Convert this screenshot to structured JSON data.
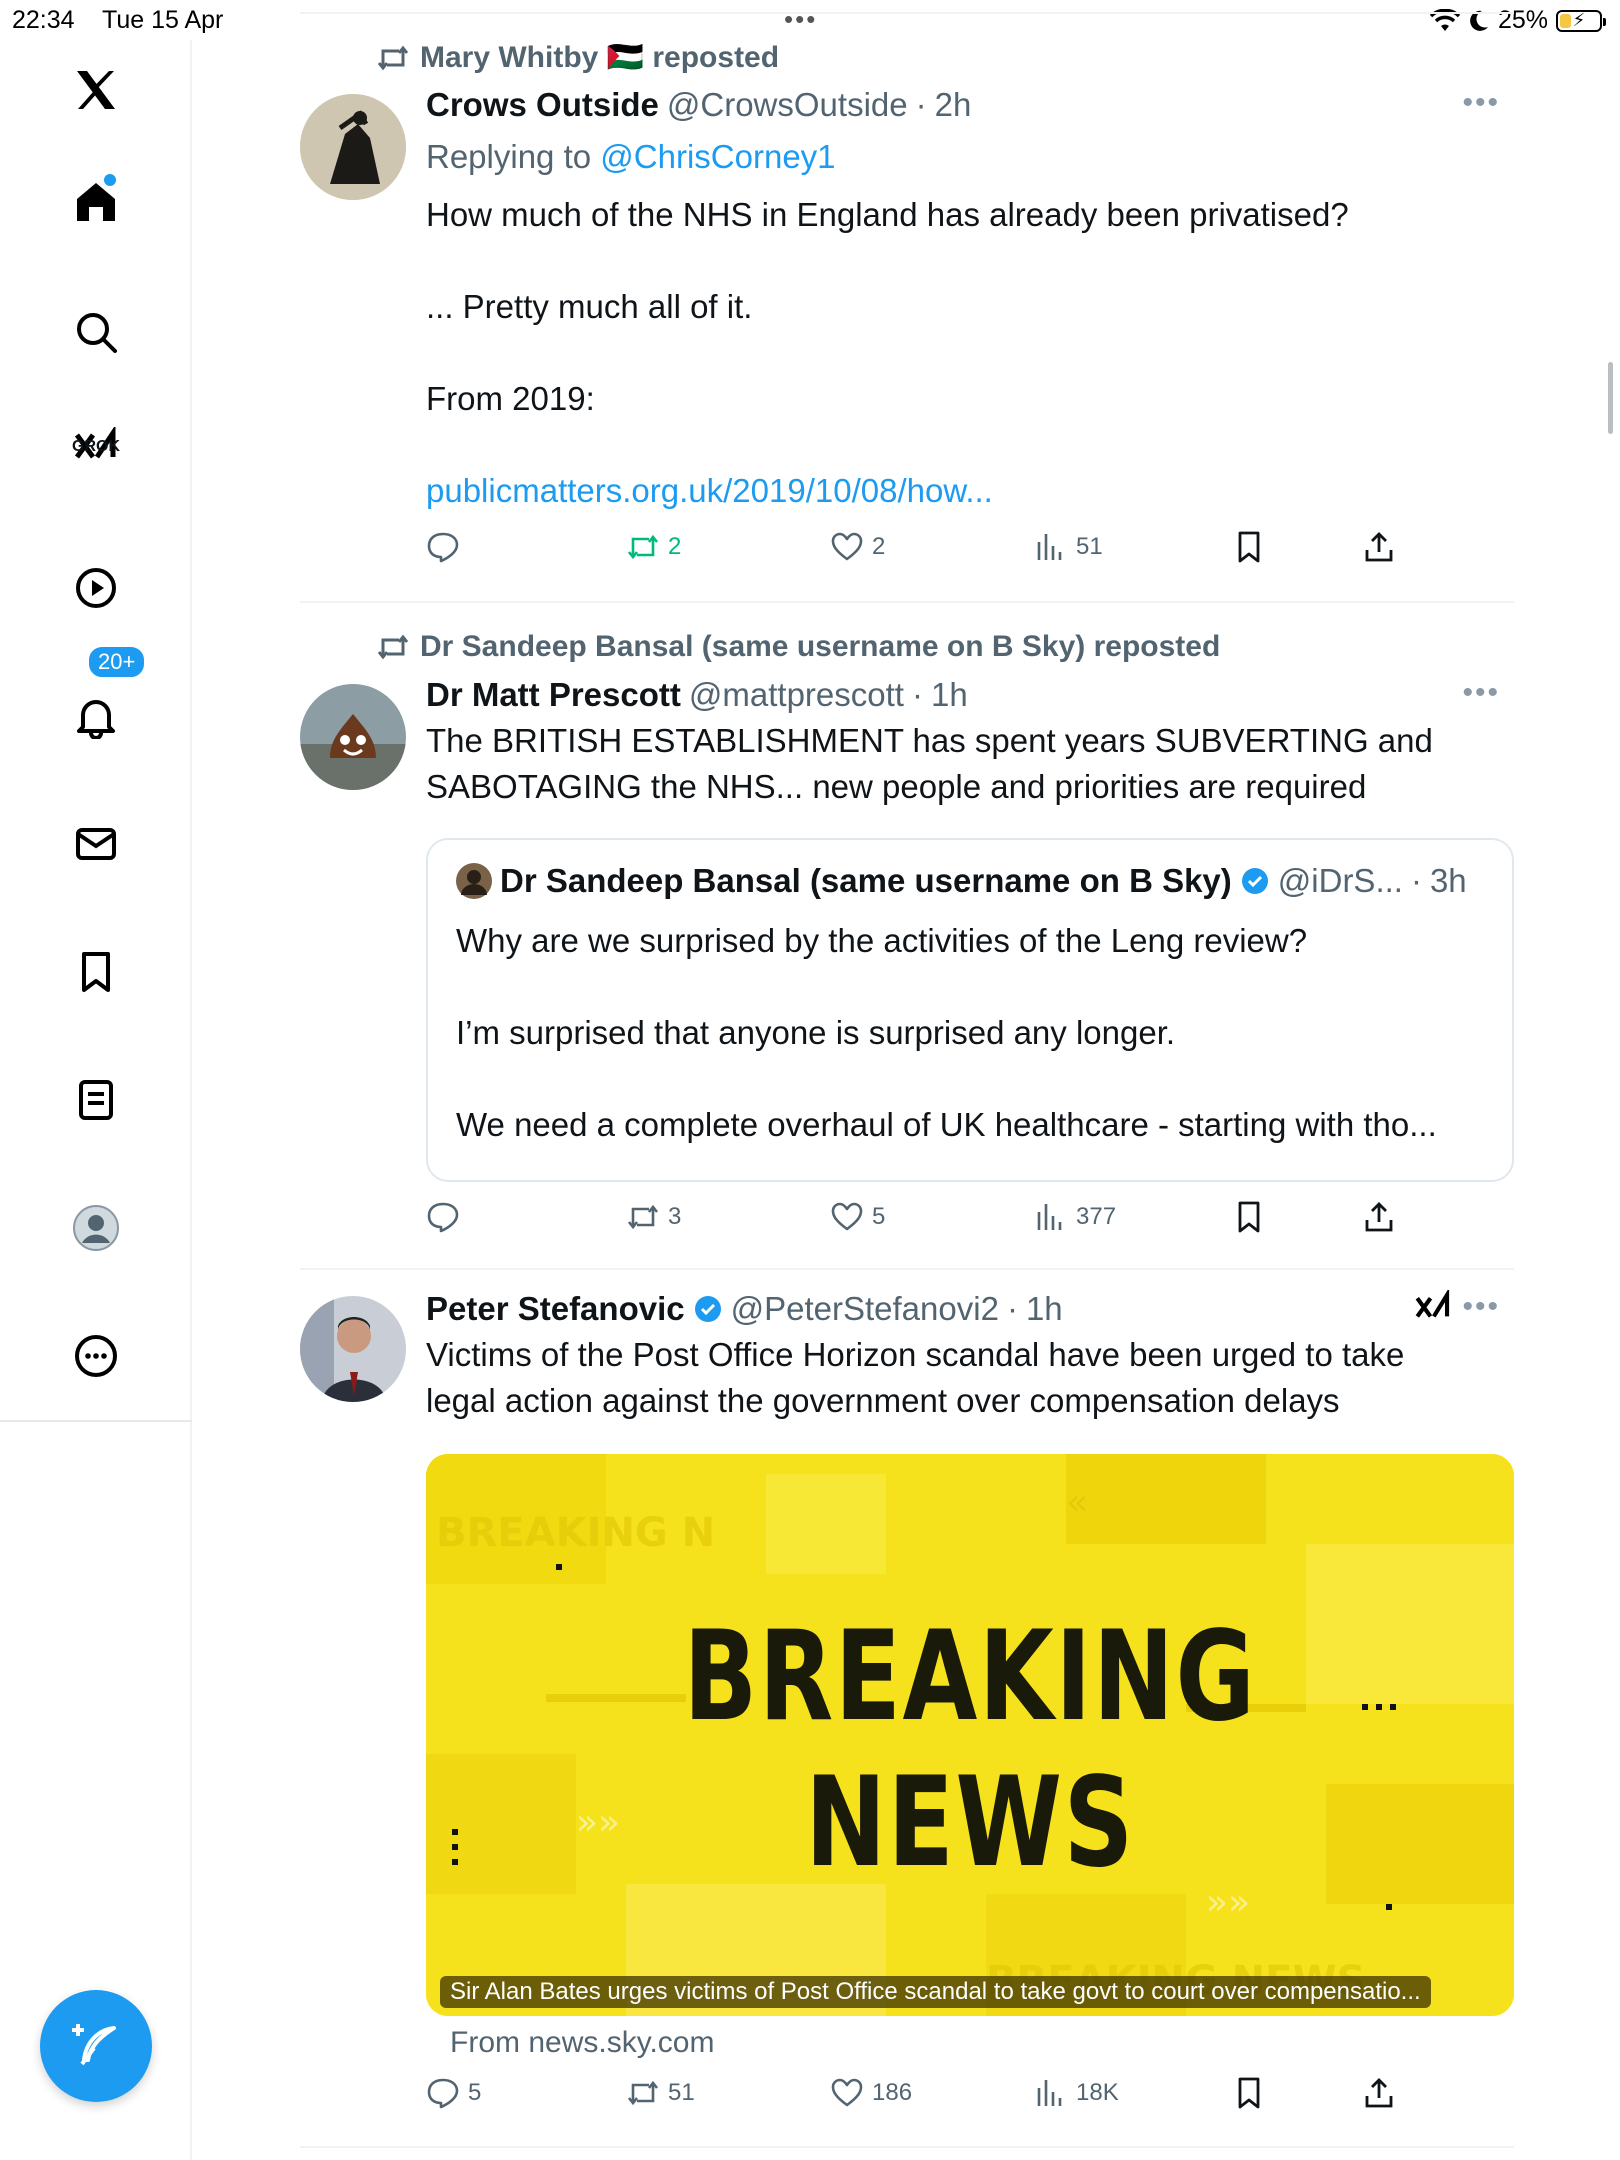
{
  "status_bar": {
    "time": "22:34",
    "date": "Tue 15 Apr",
    "battery": "25%",
    "battery_level": 0.25
  },
  "sidebar": {
    "grok_label": "GROK",
    "notifications_badge": "20+"
  },
  "tweets": [
    {
      "social_context": "Mary Whitby 🇵🇸 reposted",
      "name": "Crows Outside",
      "handle": "@CrowsOutside",
      "time": "2h",
      "reply_prefix": "Replying to",
      "reply_to": "@ChrisCorney1",
      "lines": [
        "How much of the NHS in England has already been privatised?",
        "... Pretty much all of it.",
        "From 2019:"
      ],
      "link": "publicmatters.org.uk/2019/10/08/how...",
      "replies": "",
      "reposts": "2",
      "likes": "2",
      "views": "51"
    },
    {
      "social_context": "Dr Sandeep Bansal (same username on B Sky) reposted",
      "name": "Dr Matt Prescott",
      "handle": "@mattprescott",
      "time": "1h",
      "text": "The BRITISH ESTABLISHMENT has spent years SUBVERTING and SABOTAGING the NHS... new people and priorities are required",
      "quote": {
        "name": "Dr Sandeep Bansal (same username on B Sky)",
        "handle": "@iDrS...",
        "time": "3h",
        "lines": [
          "Why are we surprised by the activities of the Leng review?",
          "I’m surprised that anyone is surprised any longer.",
          "We need a complete overhaul of UK healthcare - starting with tho..."
        ]
      },
      "replies": "",
      "reposts": "3",
      "likes": "5",
      "views": "377"
    },
    {
      "name": "Peter Stefanovic",
      "handle": "@PeterStefanovi2",
      "time": "1h",
      "text": "Victims of the Post Office Horizon scandal have been urged to take legal action against the government over compensation delays",
      "media": {
        "headline_1": "BREAKING",
        "headline_2": "NEWS",
        "caption": "Sir Alan Bates urges victims of Post Office scandal to take govt to court over compensatio...",
        "background_color": "#f5e01b"
      },
      "source": "From news.sky.com",
      "replies": "5",
      "reposts": "51",
      "likes": "186",
      "views": "18K"
    }
  ],
  "colors": {
    "accent": "#1d9bf0",
    "repost_active": "#00ba7c",
    "muted": "#536471"
  }
}
